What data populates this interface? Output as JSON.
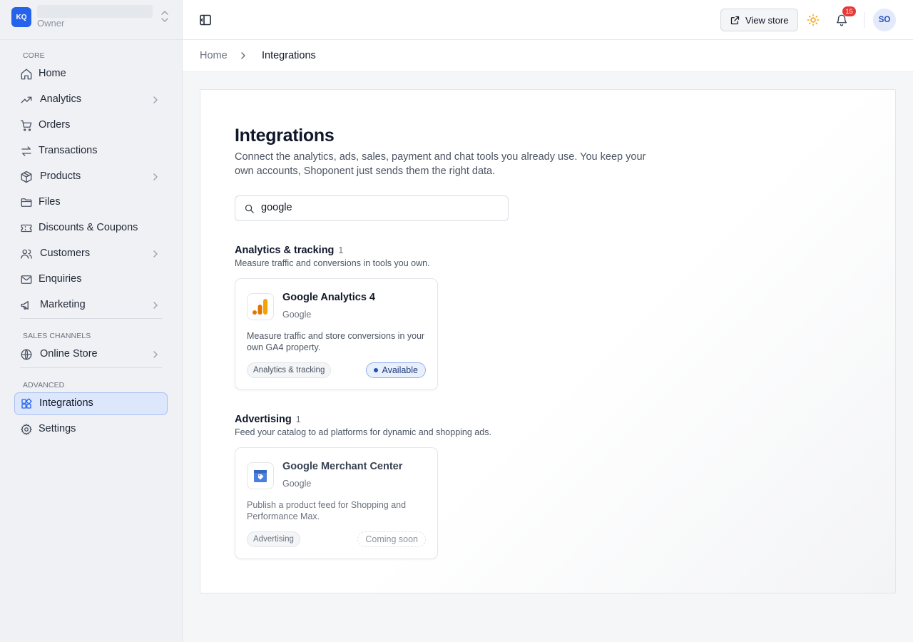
{
  "workspace": {
    "initials": "KQ",
    "role": "Owner"
  },
  "sidebar": {
    "sections": [
      {
        "label": "CORE"
      },
      {
        "label": "SALES CHANNELS"
      },
      {
        "label": "ADVANCED"
      }
    ],
    "items": [
      {
        "label": "Home"
      },
      {
        "label": "Analytics"
      },
      {
        "label": "Orders"
      },
      {
        "label": "Transactions"
      },
      {
        "label": "Products"
      },
      {
        "label": "Files"
      },
      {
        "label": "Discounts & Coupons"
      },
      {
        "label": "Customers"
      },
      {
        "label": "Enquiries"
      },
      {
        "label": "Marketing"
      },
      {
        "label": "Online Store"
      },
      {
        "label": "Integrations"
      },
      {
        "label": "Settings"
      }
    ]
  },
  "topbar": {
    "view_store_label": "View store",
    "notification_count": "15",
    "avatar_initials": "SO"
  },
  "breadcrumb": {
    "home": "Home",
    "current": "Integrations"
  },
  "page": {
    "title": "Integrations",
    "description": "Connect the analytics, ads, sales, payment and chat tools you already use. You keep your own accounts, Shoponent just sends them the right data.",
    "search_value": "google"
  },
  "groups": [
    {
      "title": "Analytics & tracking",
      "count": "1",
      "description": "Measure traffic and conversions in tools you own.",
      "integrations": [
        {
          "name": "Google Analytics 4",
          "vendor": "Google",
          "description": "Measure traffic and store conversions in your own GA4 property.",
          "tag": "Analytics & tracking",
          "status": "Available"
        }
      ]
    },
    {
      "title": "Advertising",
      "count": "1",
      "description": "Feed your catalog to ad platforms for dynamic and shopping ads.",
      "integrations": [
        {
          "name": "Google Merchant Center",
          "vendor": "Google",
          "description": "Publish a product feed for Shopping and Performance Max.",
          "tag": "Advertising",
          "status": "Coming soon"
        }
      ]
    }
  ],
  "colors": {
    "accent": "#2563eb",
    "active_nav_bg": "#dde7fb",
    "badge_red": "#e53935",
    "ga_orange": "#f4a300",
    "ga_orange_dark": "#e37400",
    "merchant_blue": "#4a7fe0"
  },
  "icons": {
    "sidebar": [
      "home-icon",
      "analytics-icon",
      "cart-icon",
      "transactions-icon",
      "box-icon",
      "folder-icon",
      "ticket-icon",
      "users-icon",
      "mail-icon",
      "megaphone-icon",
      "globe-icon",
      "integrations-icon",
      "gear-icon"
    ]
  }
}
